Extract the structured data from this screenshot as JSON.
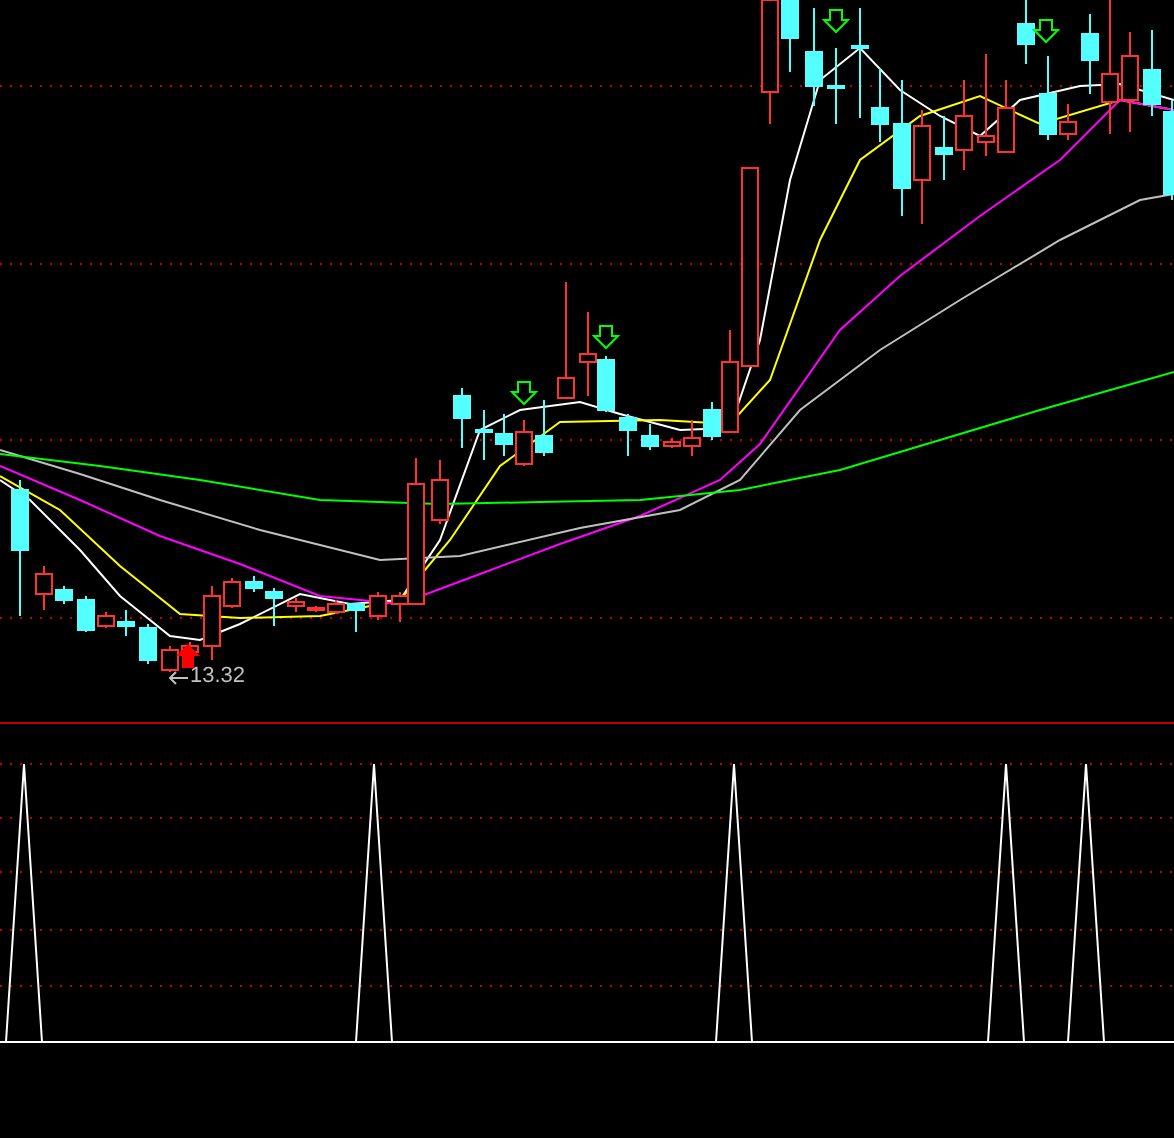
{
  "price_chart": {
    "low_price_label": "13.32"
  }
}
